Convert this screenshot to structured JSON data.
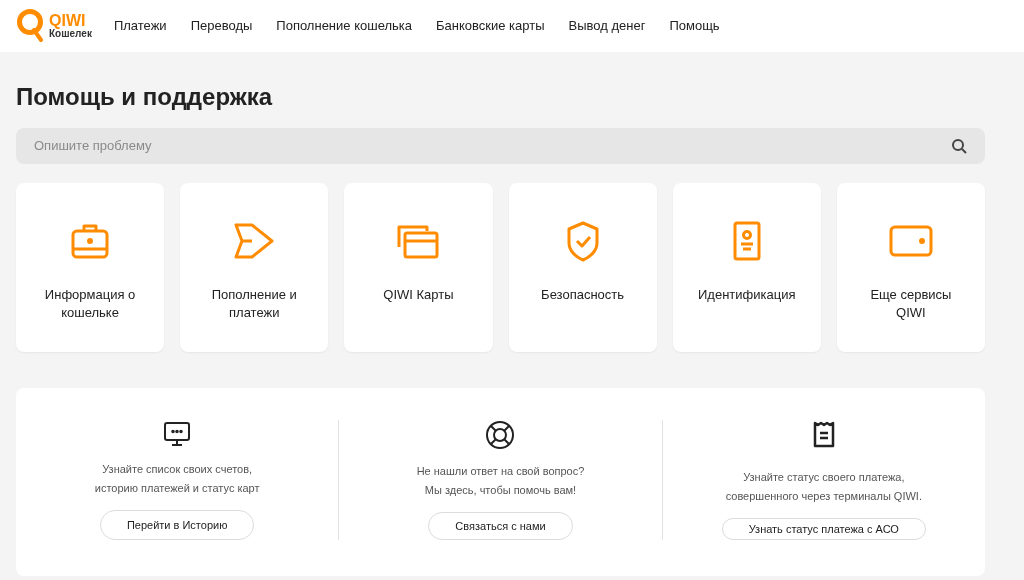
{
  "logo": {
    "brand": "QIWI",
    "product": "Кошелек"
  },
  "nav": [
    {
      "label": "Платежи"
    },
    {
      "label": "Переводы"
    },
    {
      "label": "Пополнение кошелька"
    },
    {
      "label": "Банковские карты"
    },
    {
      "label": "Вывод денег"
    },
    {
      "label": "Помощь"
    }
  ],
  "title": "Помощь и поддержка",
  "search": {
    "placeholder": "Опишите проблему"
  },
  "categories": [
    {
      "label": "Информация о кошельке"
    },
    {
      "label": "Пополнение и платежи"
    },
    {
      "label": "QIWI Карты"
    },
    {
      "label": "Безопасность"
    },
    {
      "label": "Идентификация"
    },
    {
      "label": "Еще сервисы QIWI"
    }
  ],
  "help_blocks": [
    {
      "lines": [
        "Узнайте список своих счетов,",
        "историю платежей и статус карт"
      ],
      "button": "Перейти в Историю"
    },
    {
      "lines": [
        "Не нашли ответ на свой вопрос?",
        "Мы здесь, чтобы помочь вам!"
      ],
      "button": "Связаться с нами"
    },
    {
      "lines": [
        "Узнайте статус своего платежа,",
        "совершенного через терминалы QIWI."
      ],
      "button": "Узнать статус платежа с АСО"
    }
  ]
}
